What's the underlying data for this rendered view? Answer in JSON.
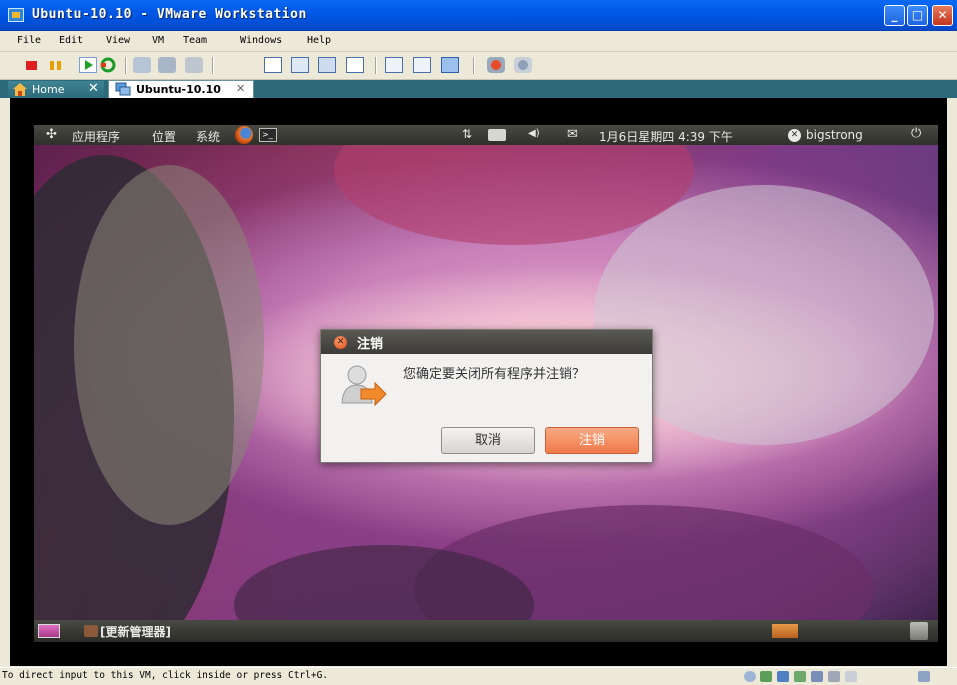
{
  "window": {
    "title": "Ubuntu-10.10 - VMware Workstation"
  },
  "menu": [
    "File",
    "Edit",
    "View",
    "VM",
    "Team",
    "Windows",
    "Help"
  ],
  "tabs": {
    "home": "Home",
    "vm": "Ubuntu-10.10"
  },
  "gnome_panel": {
    "applications": "应用程序",
    "places": "位置",
    "system": "系统",
    "datetime": "1月6日星期四 4:39 下午",
    "user": "bigstrong"
  },
  "taskbar": {
    "item": "[更新管理器]"
  },
  "dialog": {
    "title": "注销",
    "message": "您确定要关闭所有程序并注销？",
    "cancel_label": "取消",
    "confirm_label": "注销"
  },
  "status": {
    "text": "To direct input to this VM, click inside or press Ctrl+G."
  },
  "colors": {
    "titlebar": "#0058e6",
    "tab_bar": "#2c6a7a",
    "dialog_accent": "#ef7a4a",
    "panel": "#3c3b37"
  },
  "icons": [
    "vmware-app-icon",
    "minimize-icon",
    "maximize-icon",
    "close-icon",
    "power-off-icon",
    "suspend-icon",
    "power-on-icon",
    "reset-icon",
    "snapshot-icon",
    "revert-snapshot-icon",
    "snapshot-manager-icon",
    "full-screen-icon",
    "unity-icon",
    "quick-switch-icon",
    "console-view-icon",
    "home-icon",
    "tab-close-icon",
    "ubuntu-logo-icon",
    "firefox-icon",
    "terminal-icon",
    "network-icon",
    "keyboard-icon",
    "volume-icon",
    "mail-icon",
    "user-icon",
    "shutdown-icon",
    "logout-user-icon",
    "show-desktop-icon",
    "trash-icon"
  ]
}
